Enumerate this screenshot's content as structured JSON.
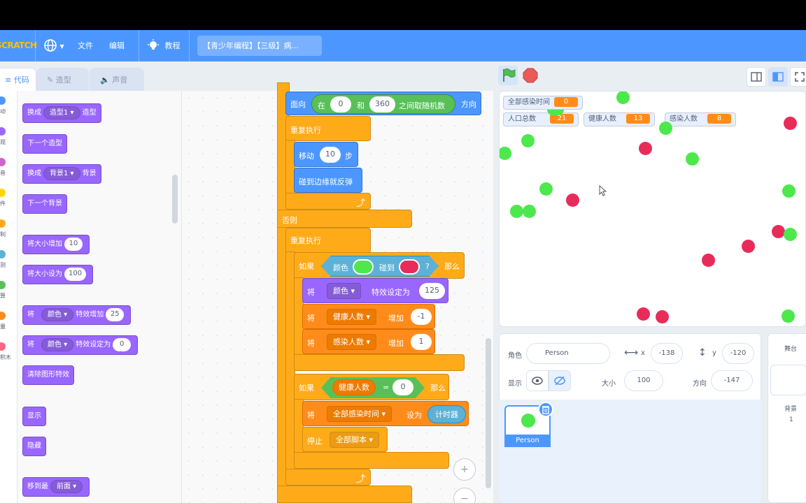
{
  "menubar": {
    "logo": "SCRATCH",
    "file": "文件",
    "edit": "编辑",
    "tutorial": "教程",
    "project_title": "【青少年编程】【三级】病..."
  },
  "tabs": {
    "code": "代码",
    "costumes": "造型",
    "sounds": "声音"
  },
  "categories": [
    {
      "label": "动",
      "color": "#4c97ff"
    },
    {
      "label": "观",
      "color": "#9966ff"
    },
    {
      "label": "音",
      "color": "#cf63cf"
    },
    {
      "label": "件",
      "color": "#ffd500"
    },
    {
      "label": "制",
      "color": "#ffab19"
    },
    {
      "label": "测",
      "color": "#5cb1d6"
    },
    {
      "label": "算",
      "color": "#59c059"
    },
    {
      "label": "量",
      "color": "#ff8c1a"
    },
    {
      "label": "积木",
      "color": "#ff6680"
    }
  ],
  "palette": {
    "switch_costume": {
      "pre": "换成",
      "dd": "造型1",
      "post": "造型"
    },
    "next_costume": "下一个造型",
    "switch_backdrop": {
      "pre": "换成",
      "dd": "背景1",
      "post": "背景"
    },
    "next_backdrop": "下一个背景",
    "change_size": {
      "pre": "将大小增加",
      "val": "10"
    },
    "set_size": {
      "pre": "将大小设为",
      "val": "100"
    },
    "change_effect": {
      "pre": "将",
      "dd": "颜色",
      "mid": "特效增加",
      "val": "25"
    },
    "set_effect": {
      "pre": "将",
      "dd": "颜色",
      "mid": "特效设定为",
      "val": "0"
    },
    "clear_effects": "清除图形特效",
    "show": "显示",
    "hide": "隐藏",
    "go_to_layer": {
      "pre": "移到最",
      "dd": "前面"
    }
  },
  "script": {
    "point_dir": {
      "pre": "面向",
      "in": "在",
      "a": "0",
      "and": "和",
      "b": "360",
      "mid": "之间取随机数",
      "post": "方向"
    },
    "forever1": "重复执行",
    "move": {
      "pre": "移动",
      "val": "10",
      "post": "步"
    },
    "bounce": "碰到边缘就反弹",
    "else": "否则",
    "forever2": "重复执行",
    "if1": {
      "pre": "如果",
      "color": "颜色",
      "touch": "碰到",
      "q": "?",
      "then": "那么",
      "c1": "#4ce84c",
      "c2": "#e82c5a"
    },
    "set_effect": {
      "pre": "将",
      "dd": "颜色",
      "mid": "特效设定为",
      "val": "125"
    },
    "change_healthy": {
      "pre": "将",
      "dd": "健康人数",
      "mid": "增加",
      "val": "-1"
    },
    "change_infected": {
      "pre": "将",
      "dd": "感染人数",
      "mid": "增加",
      "val": "1"
    },
    "if2": {
      "pre": "如果",
      "var": "健康人数",
      "eq": "=",
      "val": "0",
      "then": "那么"
    },
    "set_time": {
      "pre": "将",
      "dd": "全部感染时间",
      "mid": "设为",
      "val": "计时器"
    },
    "stop": {
      "pre": "停止",
      "dd": "全部脚本"
    }
  },
  "monitors": {
    "all_infected_time": {
      "label": "全部感染时间",
      "value": "0"
    },
    "population": {
      "label": "人口总数",
      "value": "21"
    },
    "healthy": {
      "label": "健康人数",
      "value": "13"
    },
    "infected": {
      "label": "感染人数",
      "value": "8"
    }
  },
  "sprite_info": {
    "sprite_label": "角色",
    "sprite_name": "Person",
    "x_label": "x",
    "x": "-138",
    "y_label": "y",
    "y": "-120",
    "show_label": "显示",
    "size_label": "大小",
    "size": "100",
    "direction_label": "方向",
    "direction": "-147"
  },
  "sprite_card": {
    "name": "Person"
  },
  "stage_pane": {
    "title": "舞台",
    "backdrop_label": "背景",
    "backdrop_count": "1"
  },
  "zoom": {
    "in": "+",
    "out": "−"
  }
}
